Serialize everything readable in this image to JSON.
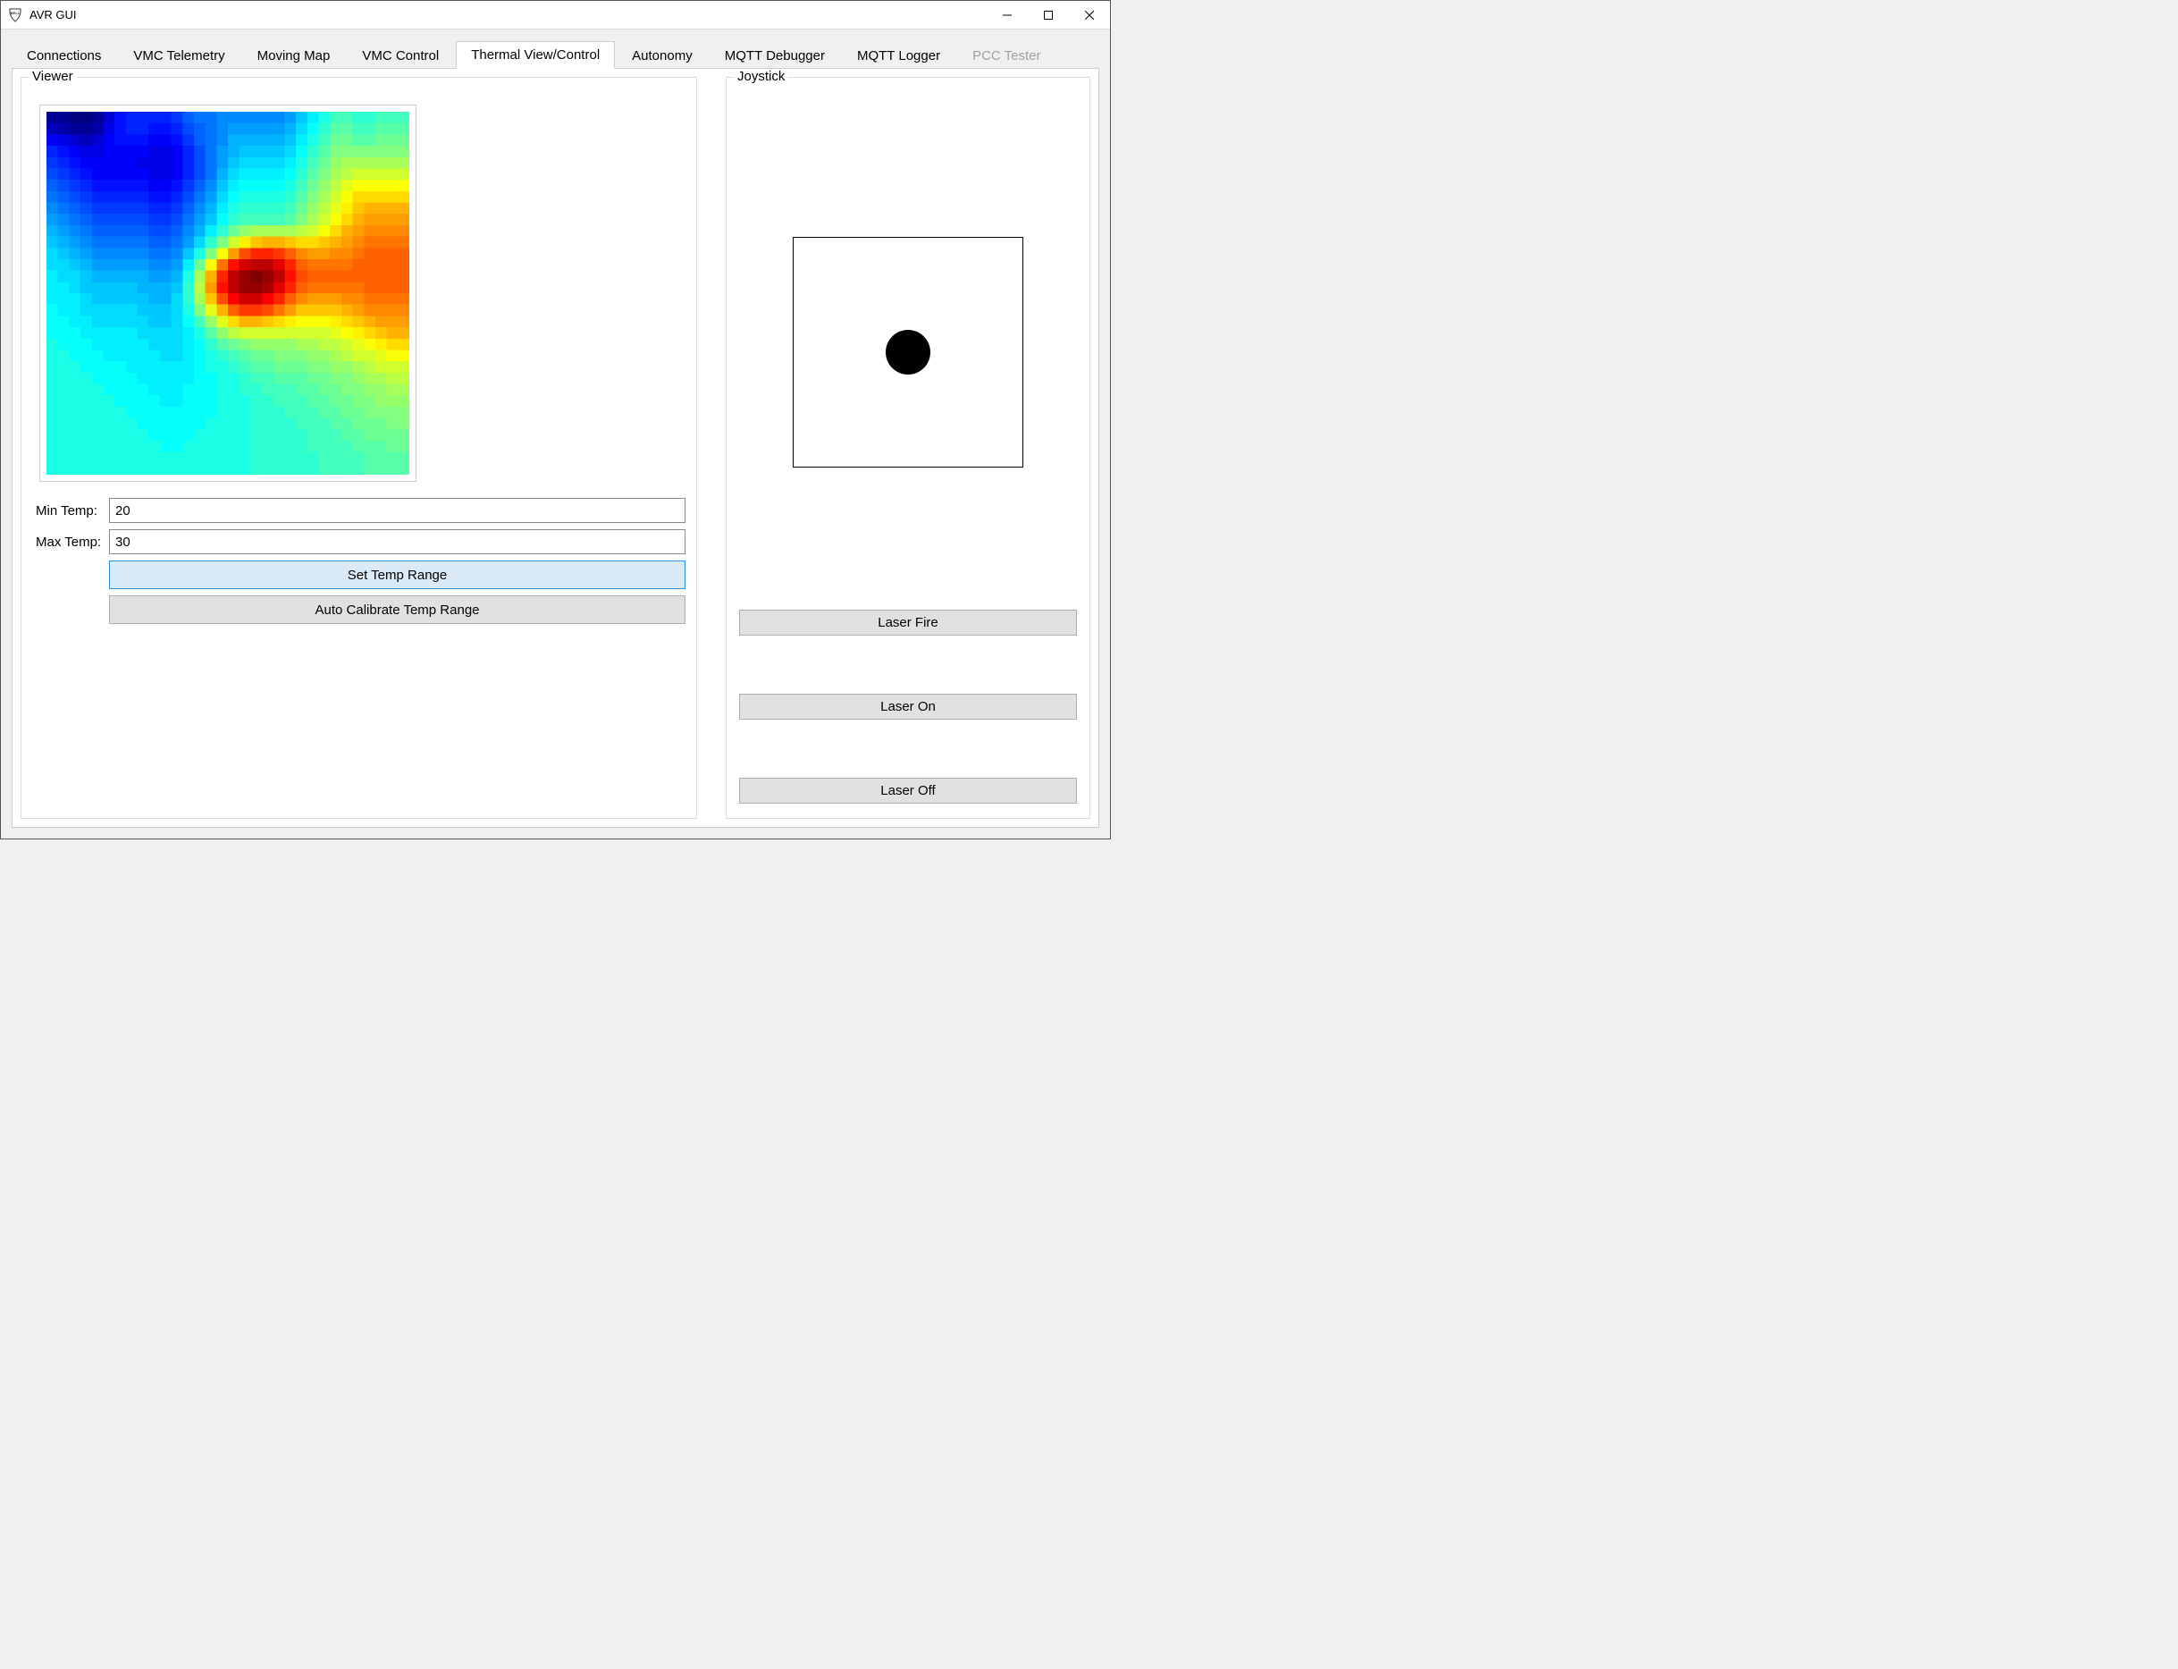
{
  "window": {
    "title": "AVR GUI"
  },
  "tabs": [
    {
      "label": "Connections",
      "active": false,
      "disabled": false
    },
    {
      "label": "VMC Telemetry",
      "active": false,
      "disabled": false
    },
    {
      "label": "Moving Map",
      "active": false,
      "disabled": false
    },
    {
      "label": "VMC Control",
      "active": false,
      "disabled": false
    },
    {
      "label": "Thermal View/Control",
      "active": true,
      "disabled": false
    },
    {
      "label": "Autonomy",
      "active": false,
      "disabled": false
    },
    {
      "label": "MQTT Debugger",
      "active": false,
      "disabled": false
    },
    {
      "label": "MQTT Logger",
      "active": false,
      "disabled": false
    },
    {
      "label": "PCC Tester",
      "active": false,
      "disabled": true
    }
  ],
  "viewer": {
    "legend": "Viewer",
    "min_temp_label": "Min Temp:",
    "min_temp_value": "20",
    "max_temp_label": "Max Temp:",
    "max_temp_value": "30",
    "set_range_label": "Set Temp Range",
    "auto_calibrate_label": "Auto Calibrate Temp Range"
  },
  "joystick": {
    "legend": "Joystick",
    "laser_fire_label": "Laser Fire",
    "laser_on_label": "Laser On",
    "laser_off_label": "Laser Off"
  },
  "thermal_grid": {
    "cols": 32,
    "rows": 32,
    "data": [
      [
        0.02,
        0.02,
        0.0,
        0.0,
        0.02,
        0.08,
        0.14,
        0.16,
        0.16,
        0.16,
        0.16,
        0.18,
        0.22,
        0.24,
        0.24,
        0.26,
        0.26,
        0.26,
        0.26,
        0.26,
        0.26,
        0.28,
        0.32,
        0.36,
        0.4,
        0.44,
        0.44,
        0.42,
        0.42,
        0.44,
        0.44,
        0.44
      ],
      [
        0.06,
        0.04,
        0.02,
        0.02,
        0.04,
        0.1,
        0.14,
        0.16,
        0.16,
        0.14,
        0.14,
        0.16,
        0.2,
        0.22,
        0.24,
        0.26,
        0.28,
        0.28,
        0.28,
        0.28,
        0.28,
        0.3,
        0.34,
        0.38,
        0.42,
        0.46,
        0.46,
        0.44,
        0.44,
        0.46,
        0.46,
        0.46
      ],
      [
        0.12,
        0.1,
        0.08,
        0.06,
        0.08,
        0.12,
        0.14,
        0.14,
        0.14,
        0.12,
        0.12,
        0.14,
        0.18,
        0.22,
        0.24,
        0.26,
        0.3,
        0.3,
        0.3,
        0.3,
        0.3,
        0.32,
        0.36,
        0.4,
        0.44,
        0.48,
        0.48,
        0.46,
        0.46,
        0.48,
        0.48,
        0.48
      ],
      [
        0.16,
        0.14,
        0.12,
        0.1,
        0.1,
        0.12,
        0.12,
        0.12,
        0.12,
        0.1,
        0.1,
        0.12,
        0.16,
        0.2,
        0.24,
        0.28,
        0.3,
        0.32,
        0.32,
        0.32,
        0.32,
        0.34,
        0.38,
        0.42,
        0.46,
        0.5,
        0.5,
        0.5,
        0.5,
        0.5,
        0.5,
        0.5
      ],
      [
        0.18,
        0.16,
        0.14,
        0.12,
        0.12,
        0.12,
        0.12,
        0.12,
        0.1,
        0.1,
        0.1,
        0.12,
        0.16,
        0.2,
        0.24,
        0.28,
        0.32,
        0.34,
        0.34,
        0.34,
        0.34,
        0.36,
        0.4,
        0.44,
        0.48,
        0.52,
        0.54,
        0.54,
        0.54,
        0.54,
        0.54,
        0.54
      ],
      [
        0.2,
        0.18,
        0.16,
        0.14,
        0.12,
        0.12,
        0.12,
        0.12,
        0.12,
        0.1,
        0.1,
        0.12,
        0.16,
        0.2,
        0.24,
        0.3,
        0.34,
        0.36,
        0.36,
        0.36,
        0.36,
        0.38,
        0.42,
        0.46,
        0.5,
        0.54,
        0.56,
        0.58,
        0.58,
        0.58,
        0.58,
        0.58
      ],
      [
        0.22,
        0.2,
        0.18,
        0.16,
        0.14,
        0.14,
        0.14,
        0.14,
        0.14,
        0.12,
        0.12,
        0.14,
        0.18,
        0.22,
        0.26,
        0.32,
        0.36,
        0.38,
        0.38,
        0.38,
        0.38,
        0.4,
        0.44,
        0.48,
        0.52,
        0.56,
        0.6,
        0.62,
        0.62,
        0.62,
        0.62,
        0.62
      ],
      [
        0.24,
        0.22,
        0.2,
        0.18,
        0.16,
        0.16,
        0.16,
        0.16,
        0.16,
        0.14,
        0.14,
        0.16,
        0.2,
        0.24,
        0.28,
        0.34,
        0.38,
        0.4,
        0.4,
        0.4,
        0.4,
        0.42,
        0.46,
        0.5,
        0.54,
        0.58,
        0.62,
        0.66,
        0.66,
        0.66,
        0.66,
        0.66
      ],
      [
        0.26,
        0.24,
        0.22,
        0.2,
        0.18,
        0.18,
        0.18,
        0.18,
        0.18,
        0.16,
        0.16,
        0.18,
        0.22,
        0.26,
        0.3,
        0.36,
        0.4,
        0.42,
        0.42,
        0.42,
        0.42,
        0.44,
        0.48,
        0.52,
        0.56,
        0.6,
        0.64,
        0.68,
        0.7,
        0.7,
        0.7,
        0.7
      ],
      [
        0.28,
        0.26,
        0.24,
        0.22,
        0.2,
        0.2,
        0.2,
        0.2,
        0.2,
        0.18,
        0.18,
        0.2,
        0.24,
        0.28,
        0.32,
        0.38,
        0.42,
        0.44,
        0.44,
        0.44,
        0.44,
        0.46,
        0.5,
        0.54,
        0.58,
        0.62,
        0.66,
        0.7,
        0.72,
        0.72,
        0.72,
        0.72
      ],
      [
        0.3,
        0.28,
        0.26,
        0.24,
        0.22,
        0.22,
        0.22,
        0.22,
        0.22,
        0.2,
        0.2,
        0.22,
        0.26,
        0.3,
        0.36,
        0.42,
        0.48,
        0.52,
        0.54,
        0.54,
        0.54,
        0.54,
        0.56,
        0.58,
        0.62,
        0.66,
        0.7,
        0.72,
        0.74,
        0.74,
        0.74,
        0.74
      ],
      [
        0.32,
        0.3,
        0.28,
        0.26,
        0.24,
        0.24,
        0.24,
        0.24,
        0.24,
        0.22,
        0.22,
        0.24,
        0.28,
        0.34,
        0.42,
        0.5,
        0.58,
        0.64,
        0.68,
        0.7,
        0.7,
        0.68,
        0.66,
        0.66,
        0.68,
        0.7,
        0.72,
        0.74,
        0.76,
        0.76,
        0.76,
        0.76
      ],
      [
        0.34,
        0.32,
        0.3,
        0.28,
        0.26,
        0.26,
        0.26,
        0.26,
        0.26,
        0.24,
        0.24,
        0.26,
        0.32,
        0.4,
        0.5,
        0.62,
        0.72,
        0.8,
        0.84,
        0.84,
        0.82,
        0.78,
        0.74,
        0.72,
        0.72,
        0.74,
        0.74,
        0.76,
        0.78,
        0.78,
        0.78,
        0.78
      ],
      [
        0.34,
        0.34,
        0.32,
        0.3,
        0.28,
        0.28,
        0.28,
        0.28,
        0.28,
        0.26,
        0.26,
        0.28,
        0.36,
        0.48,
        0.62,
        0.76,
        0.86,
        0.92,
        0.94,
        0.94,
        0.9,
        0.84,
        0.78,
        0.76,
        0.76,
        0.76,
        0.76,
        0.78,
        0.78,
        0.78,
        0.78,
        0.78
      ],
      [
        0.36,
        0.34,
        0.34,
        0.32,
        0.3,
        0.3,
        0.3,
        0.3,
        0.3,
        0.28,
        0.28,
        0.3,
        0.4,
        0.54,
        0.7,
        0.84,
        0.94,
        0.98,
        1.0,
        0.98,
        0.94,
        0.86,
        0.8,
        0.78,
        0.78,
        0.78,
        0.78,
        0.78,
        0.78,
        0.78,
        0.78,
        0.78
      ],
      [
        0.36,
        0.36,
        0.34,
        0.32,
        0.32,
        0.32,
        0.32,
        0.32,
        0.3,
        0.3,
        0.3,
        0.32,
        0.42,
        0.56,
        0.72,
        0.86,
        0.94,
        0.98,
        0.98,
        0.96,
        0.9,
        0.84,
        0.78,
        0.76,
        0.76,
        0.76,
        0.76,
        0.76,
        0.78,
        0.78,
        0.78,
        0.78
      ],
      [
        0.36,
        0.36,
        0.36,
        0.34,
        0.32,
        0.32,
        0.32,
        0.32,
        0.32,
        0.3,
        0.3,
        0.34,
        0.42,
        0.54,
        0.68,
        0.8,
        0.88,
        0.92,
        0.92,
        0.88,
        0.84,
        0.78,
        0.74,
        0.72,
        0.72,
        0.72,
        0.74,
        0.74,
        0.76,
        0.76,
        0.76,
        0.76
      ],
      [
        0.38,
        0.36,
        0.36,
        0.34,
        0.34,
        0.34,
        0.34,
        0.34,
        0.32,
        0.32,
        0.32,
        0.34,
        0.4,
        0.5,
        0.6,
        0.7,
        0.78,
        0.82,
        0.82,
        0.8,
        0.76,
        0.72,
        0.68,
        0.68,
        0.68,
        0.68,
        0.7,
        0.72,
        0.74,
        0.74,
        0.74,
        0.74
      ],
      [
        0.38,
        0.38,
        0.36,
        0.36,
        0.34,
        0.34,
        0.34,
        0.34,
        0.34,
        0.32,
        0.32,
        0.34,
        0.38,
        0.44,
        0.52,
        0.6,
        0.66,
        0.7,
        0.7,
        0.68,
        0.66,
        0.64,
        0.62,
        0.62,
        0.62,
        0.64,
        0.66,
        0.68,
        0.7,
        0.72,
        0.72,
        0.72
      ],
      [
        0.38,
        0.38,
        0.38,
        0.36,
        0.36,
        0.36,
        0.36,
        0.36,
        0.34,
        0.34,
        0.34,
        0.34,
        0.36,
        0.4,
        0.46,
        0.52,
        0.56,
        0.58,
        0.58,
        0.58,
        0.58,
        0.58,
        0.58,
        0.58,
        0.58,
        0.6,
        0.62,
        0.64,
        0.66,
        0.68,
        0.7,
        0.7
      ],
      [
        0.4,
        0.38,
        0.38,
        0.38,
        0.36,
        0.36,
        0.36,
        0.36,
        0.36,
        0.34,
        0.34,
        0.34,
        0.36,
        0.38,
        0.42,
        0.46,
        0.48,
        0.5,
        0.52,
        0.52,
        0.52,
        0.52,
        0.54,
        0.54,
        0.56,
        0.56,
        0.58,
        0.6,
        0.62,
        0.64,
        0.66,
        0.66
      ],
      [
        0.4,
        0.4,
        0.38,
        0.38,
        0.38,
        0.36,
        0.36,
        0.36,
        0.36,
        0.36,
        0.34,
        0.34,
        0.36,
        0.38,
        0.4,
        0.42,
        0.44,
        0.46,
        0.48,
        0.48,
        0.5,
        0.5,
        0.5,
        0.52,
        0.52,
        0.54,
        0.56,
        0.58,
        0.58,
        0.6,
        0.62,
        0.62
      ],
      [
        0.4,
        0.4,
        0.4,
        0.38,
        0.38,
        0.38,
        0.38,
        0.36,
        0.36,
        0.36,
        0.36,
        0.36,
        0.36,
        0.38,
        0.4,
        0.4,
        0.42,
        0.44,
        0.46,
        0.46,
        0.48,
        0.48,
        0.48,
        0.5,
        0.5,
        0.52,
        0.52,
        0.54,
        0.56,
        0.58,
        0.58,
        0.58
      ],
      [
        0.4,
        0.4,
        0.4,
        0.4,
        0.38,
        0.38,
        0.38,
        0.38,
        0.36,
        0.36,
        0.36,
        0.36,
        0.36,
        0.38,
        0.38,
        0.4,
        0.4,
        0.42,
        0.44,
        0.44,
        0.46,
        0.46,
        0.46,
        0.48,
        0.48,
        0.5,
        0.5,
        0.52,
        0.54,
        0.54,
        0.56,
        0.56
      ],
      [
        0.4,
        0.4,
        0.4,
        0.4,
        0.4,
        0.38,
        0.38,
        0.38,
        0.38,
        0.36,
        0.36,
        0.36,
        0.38,
        0.38,
        0.38,
        0.4,
        0.4,
        0.42,
        0.42,
        0.44,
        0.44,
        0.44,
        0.46,
        0.46,
        0.48,
        0.48,
        0.5,
        0.5,
        0.52,
        0.52,
        0.54,
        0.54
      ],
      [
        0.4,
        0.4,
        0.4,
        0.4,
        0.4,
        0.4,
        0.38,
        0.38,
        0.38,
        0.38,
        0.36,
        0.36,
        0.38,
        0.38,
        0.38,
        0.4,
        0.4,
        0.4,
        0.42,
        0.42,
        0.44,
        0.44,
        0.44,
        0.46,
        0.46,
        0.48,
        0.48,
        0.5,
        0.5,
        0.52,
        0.52,
        0.52
      ],
      [
        0.4,
        0.4,
        0.4,
        0.4,
        0.4,
        0.4,
        0.4,
        0.38,
        0.38,
        0.38,
        0.38,
        0.38,
        0.38,
        0.38,
        0.38,
        0.4,
        0.4,
        0.4,
        0.42,
        0.42,
        0.42,
        0.44,
        0.44,
        0.44,
        0.46,
        0.46,
        0.48,
        0.48,
        0.5,
        0.5,
        0.5,
        0.5
      ],
      [
        0.4,
        0.4,
        0.4,
        0.4,
        0.4,
        0.4,
        0.4,
        0.4,
        0.38,
        0.38,
        0.38,
        0.38,
        0.38,
        0.38,
        0.4,
        0.4,
        0.4,
        0.4,
        0.42,
        0.42,
        0.42,
        0.42,
        0.44,
        0.44,
        0.44,
        0.46,
        0.46,
        0.48,
        0.48,
        0.48,
        0.5,
        0.5
      ],
      [
        0.4,
        0.4,
        0.4,
        0.4,
        0.4,
        0.4,
        0.4,
        0.4,
        0.4,
        0.38,
        0.38,
        0.38,
        0.38,
        0.4,
        0.4,
        0.4,
        0.4,
        0.4,
        0.42,
        0.42,
        0.42,
        0.42,
        0.42,
        0.44,
        0.44,
        0.44,
        0.46,
        0.46,
        0.48,
        0.48,
        0.48,
        0.48
      ],
      [
        0.4,
        0.4,
        0.4,
        0.4,
        0.4,
        0.4,
        0.4,
        0.4,
        0.4,
        0.4,
        0.38,
        0.38,
        0.4,
        0.4,
        0.4,
        0.4,
        0.4,
        0.4,
        0.42,
        0.42,
        0.42,
        0.42,
        0.42,
        0.44,
        0.44,
        0.44,
        0.44,
        0.46,
        0.46,
        0.46,
        0.48,
        0.48
      ],
      [
        0.4,
        0.4,
        0.4,
        0.4,
        0.4,
        0.4,
        0.4,
        0.4,
        0.4,
        0.4,
        0.4,
        0.4,
        0.4,
        0.4,
        0.4,
        0.4,
        0.4,
        0.4,
        0.42,
        0.42,
        0.42,
        0.42,
        0.42,
        0.42,
        0.44,
        0.44,
        0.44,
        0.44,
        0.46,
        0.46,
        0.46,
        0.46
      ],
      [
        0.4,
        0.4,
        0.4,
        0.4,
        0.4,
        0.4,
        0.4,
        0.4,
        0.4,
        0.4,
        0.4,
        0.4,
        0.4,
        0.4,
        0.4,
        0.4,
        0.4,
        0.4,
        0.42,
        0.42,
        0.42,
        0.42,
        0.42,
        0.42,
        0.44,
        0.44,
        0.44,
        0.44,
        0.46,
        0.46,
        0.46,
        0.46
      ]
    ]
  }
}
